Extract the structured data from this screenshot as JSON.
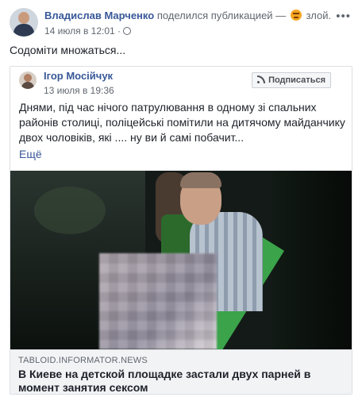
{
  "header": {
    "author": "Владислав Марченко",
    "action": "поделился публикацией —",
    "feeling": "злой.",
    "timestamp": "14 июля в 12:01 ·",
    "more_icon": "more-dots-icon",
    "privacy_icon": "globe-icon"
  },
  "caption": "Содоміти множаться...",
  "shared": {
    "author": "Ігор Мосійчук",
    "timestamp": "13 июля в 19:36",
    "subscribe_label": "Подписаться",
    "text": "Днями, під час нічого патрулювання в одному зі спальних районів столиці, поліцейські помітили на дитячому майданчику двох чоловіків, які .... ну ви й самі побачит...",
    "more_label": "Ещё",
    "link": {
      "domain": "TABLOID.INFORMATOR.NEWS",
      "title": "В Киеве на детской площадке застали двух парней в момент занятия сексом"
    }
  },
  "colors": {
    "link": "#385898",
    "text": "#1d2129",
    "meta": "#616770",
    "border": "#dddfe2"
  }
}
